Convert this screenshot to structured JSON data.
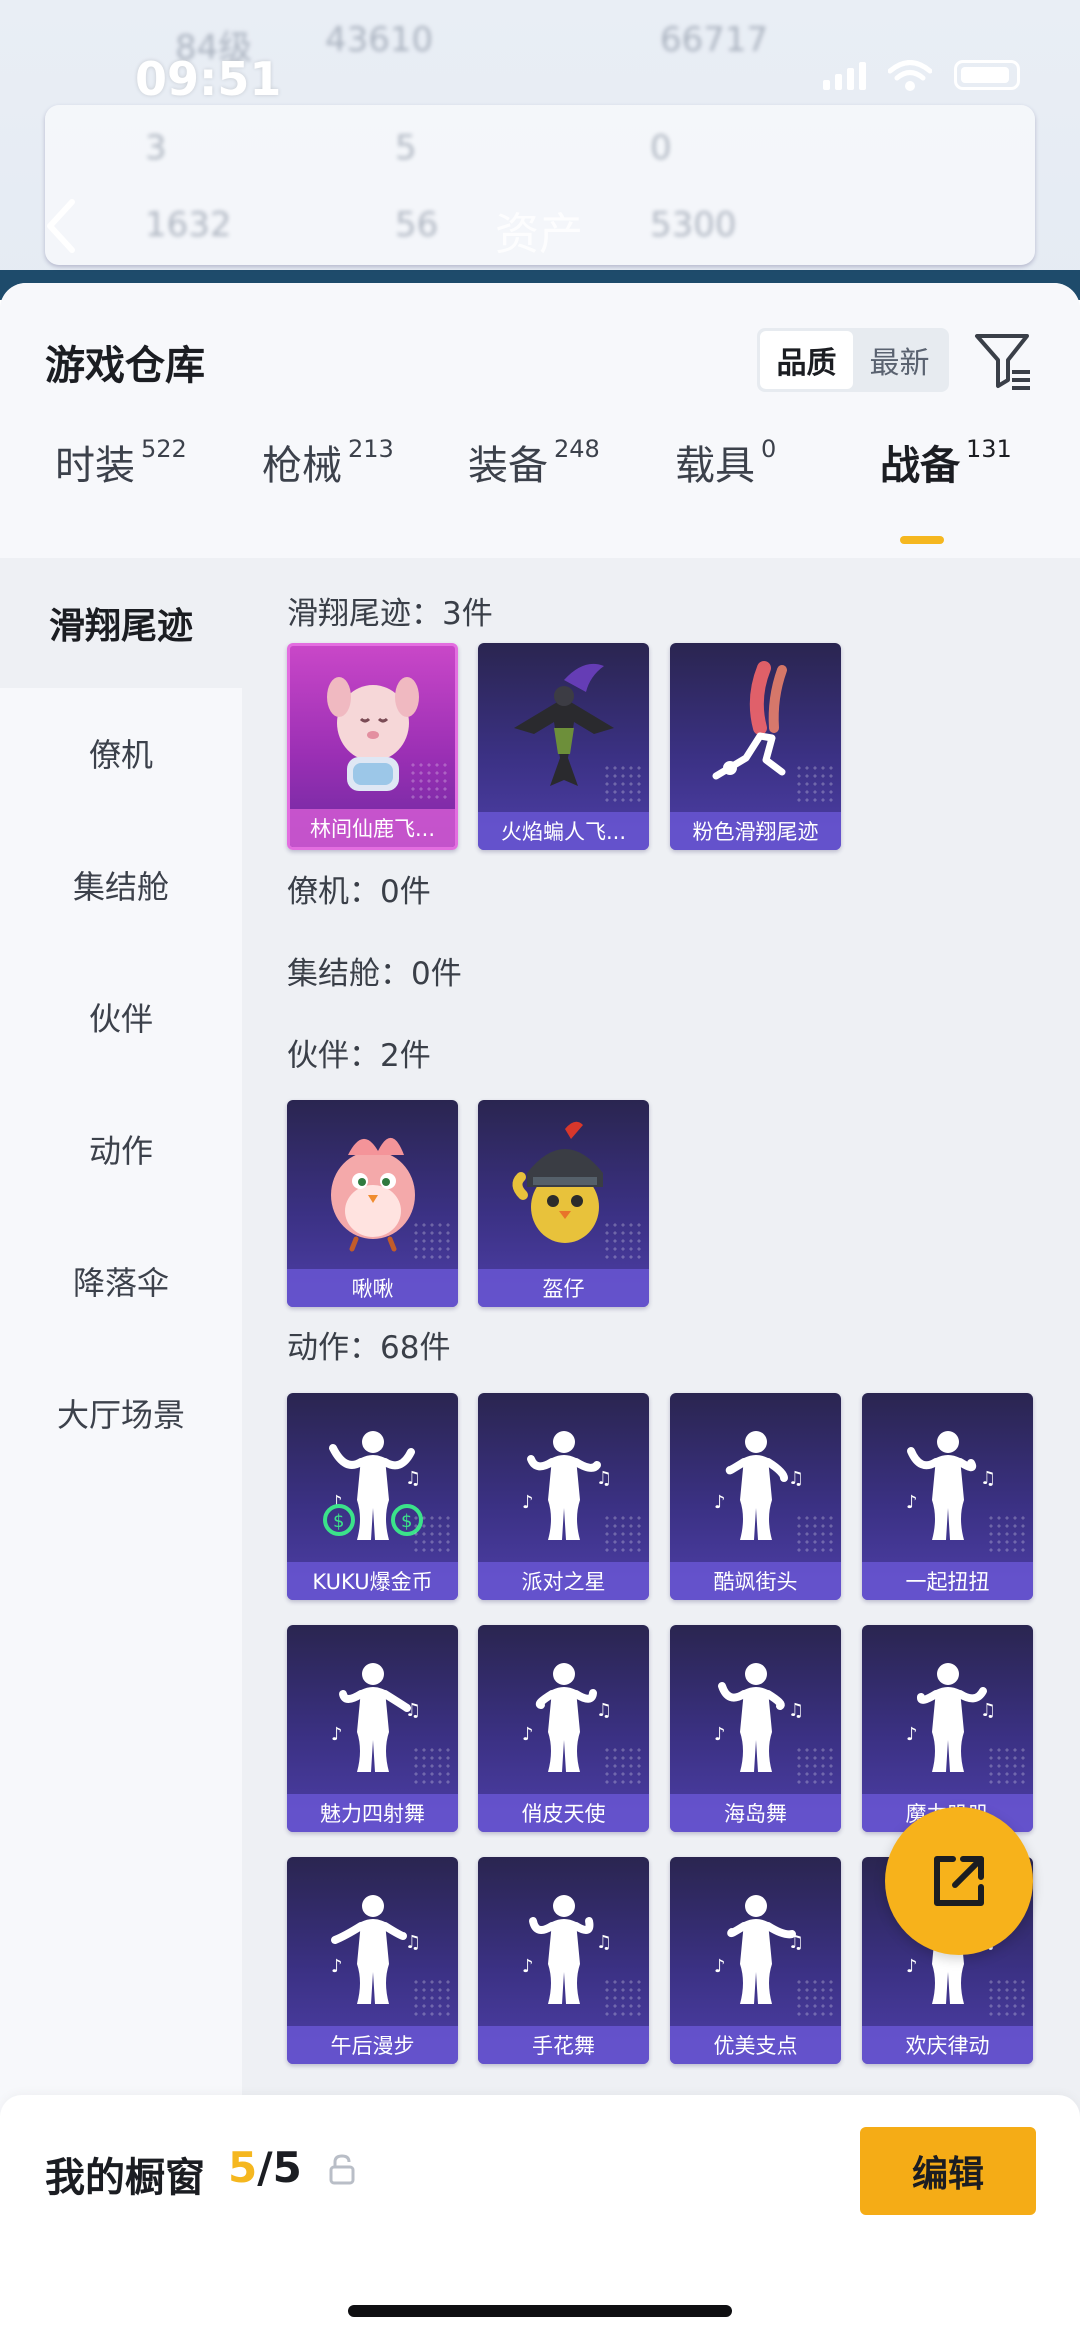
{
  "status_bar": {
    "time": "09:51"
  },
  "background_header": {
    "title": "资产",
    "blurred_texts": [
      "84级",
      "43610",
      "66717",
      "3",
      "5",
      "0",
      "1632",
      "56",
      "5300"
    ]
  },
  "sheet": {
    "title": "游戏仓库",
    "sort_options": [
      {
        "label": "品质",
        "active": true
      },
      {
        "label": "最新",
        "active": false
      }
    ]
  },
  "tabs": [
    {
      "label": "时装",
      "count": "522"
    },
    {
      "label": "枪械",
      "count": "213"
    },
    {
      "label": "装备",
      "count": "248"
    },
    {
      "label": "载具",
      "count": "0"
    },
    {
      "label": "战备",
      "count": "131",
      "active": true
    }
  ],
  "sidebar": {
    "items": [
      {
        "label": "滑翔尾迹",
        "active": true
      },
      {
        "label": "僚机"
      },
      {
        "label": "集结舱"
      },
      {
        "label": "伙伴"
      },
      {
        "label": "动作"
      },
      {
        "label": "降落伞"
      },
      {
        "label": "大厅场景"
      }
    ]
  },
  "sections": [
    {
      "title": "滑翔尾迹：3件",
      "items": [
        "林间仙鹿飞...",
        "火焰蝙人飞...",
        "粉色滑翔尾迹"
      ]
    },
    {
      "title": "僚机：0件",
      "items": []
    },
    {
      "title": "集结舱：0件",
      "items": []
    },
    {
      "title": "伙伴：2件",
      "items": [
        "啾啾",
        "盔仔"
      ]
    },
    {
      "title": "动作：68件",
      "items": [
        "KUKU爆金币",
        "派对之星",
        "酷飒街头",
        "一起扭扭",
        "魅力四射舞",
        "俏皮天使",
        "海岛舞",
        "魔力叽叽",
        "午后漫步",
        "手花舞",
        "优美支点",
        "欢庆律动"
      ]
    }
  ],
  "bottom_bar": {
    "label": "我的橱窗",
    "count_current": "5",
    "count_total": "/5",
    "edit_label": "编辑"
  },
  "colors": {
    "accent": "#f5b71f",
    "card_purple": "#3b3184",
    "card_pink": "#c947c8",
    "card_label": "#6856d2"
  },
  "icons": [
    "back-arrow-icon",
    "filter-icon",
    "share-icon",
    "lock-icon",
    "signal-icon",
    "wifi-icon",
    "battery-icon"
  ]
}
